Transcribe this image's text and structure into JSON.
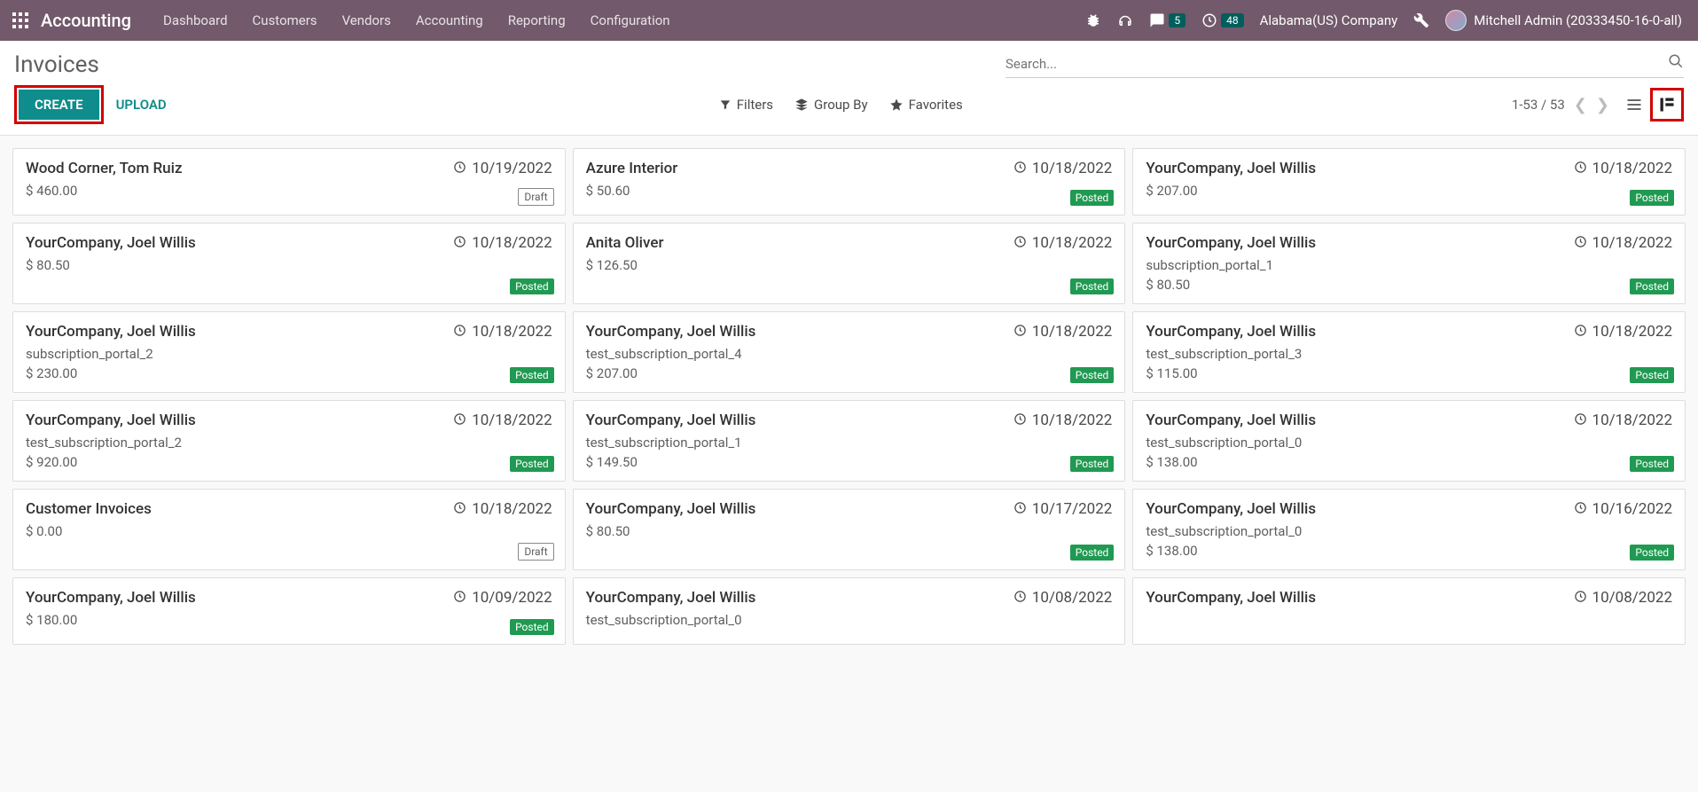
{
  "navbar": {
    "app_name": "Accounting",
    "menu": [
      "Dashboard",
      "Customers",
      "Vendors",
      "Accounting",
      "Reporting",
      "Configuration"
    ],
    "messages_badge": "5",
    "activities_badge": "48",
    "company": "Alabama(US) Company",
    "user": "Mitchell Admin (20333450-16-0-all)"
  },
  "control": {
    "breadcrumb": "Invoices",
    "search_placeholder": "Search...",
    "create": "CREATE",
    "upload": "UPLOAD",
    "filters": "Filters",
    "groupby": "Group By",
    "favorites": "Favorites",
    "pager": "1-53 / 53"
  },
  "status_labels": {
    "posted": "Posted",
    "draft": "Draft"
  },
  "cards": [
    {
      "title": "Wood Corner, Tom Ruiz",
      "date": "10/19/2022",
      "ref": "",
      "amount": "$ 460.00",
      "status": "draft"
    },
    {
      "title": "Azure Interior",
      "date": "10/18/2022",
      "ref": "",
      "amount": "$ 50.60",
      "status": "posted"
    },
    {
      "title": "YourCompany, Joel Willis",
      "date": "10/18/2022",
      "ref": "",
      "amount": "$ 207.00",
      "status": "posted"
    },
    {
      "title": "YourCompany, Joel Willis",
      "date": "10/18/2022",
      "ref": "",
      "amount": "$ 80.50",
      "status": "posted"
    },
    {
      "title": "Anita Oliver",
      "date": "10/18/2022",
      "ref": "",
      "amount": "$ 126.50",
      "status": "posted"
    },
    {
      "title": "YourCompany, Joel Willis",
      "date": "10/18/2022",
      "ref": "subscription_portal_1",
      "amount": "$ 80.50",
      "status": "posted"
    },
    {
      "title": "YourCompany, Joel Willis",
      "date": "10/18/2022",
      "ref": "subscription_portal_2",
      "amount": "$ 230.00",
      "status": "posted"
    },
    {
      "title": "YourCompany, Joel Willis",
      "date": "10/18/2022",
      "ref": "test_subscription_portal_4",
      "amount": "$ 207.00",
      "status": "posted"
    },
    {
      "title": "YourCompany, Joel Willis",
      "date": "10/18/2022",
      "ref": "test_subscription_portal_3",
      "amount": "$ 115.00",
      "status": "posted"
    },
    {
      "title": "YourCompany, Joel Willis",
      "date": "10/18/2022",
      "ref": "test_subscription_portal_2",
      "amount": "$ 920.00",
      "status": "posted"
    },
    {
      "title": "YourCompany, Joel Willis",
      "date": "10/18/2022",
      "ref": "test_subscription_portal_1",
      "amount": "$ 149.50",
      "status": "posted"
    },
    {
      "title": "YourCompany, Joel Willis",
      "date": "10/18/2022",
      "ref": "test_subscription_portal_0",
      "amount": "$ 138.00",
      "status": "posted"
    },
    {
      "title": "Customer Invoices",
      "date": "10/18/2022",
      "ref": "",
      "amount": "$ 0.00",
      "status": "draft"
    },
    {
      "title": "YourCompany, Joel Willis",
      "date": "10/17/2022",
      "ref": "",
      "amount": "$ 80.50",
      "status": "posted"
    },
    {
      "title": "YourCompany, Joel Willis",
      "date": "10/16/2022",
      "ref": "test_subscription_portal_0",
      "amount": "$ 138.00",
      "status": "posted"
    },
    {
      "title": "YourCompany, Joel Willis",
      "date": "10/09/2022",
      "ref": "",
      "amount": "$ 180.00",
      "status": "posted"
    },
    {
      "title": "YourCompany, Joel Willis",
      "date": "10/08/2022",
      "ref": "test_subscription_portal_0",
      "amount": "",
      "status": ""
    },
    {
      "title": "YourCompany, Joel Willis",
      "date": "10/08/2022",
      "ref": "",
      "amount": "",
      "status": ""
    }
  ]
}
